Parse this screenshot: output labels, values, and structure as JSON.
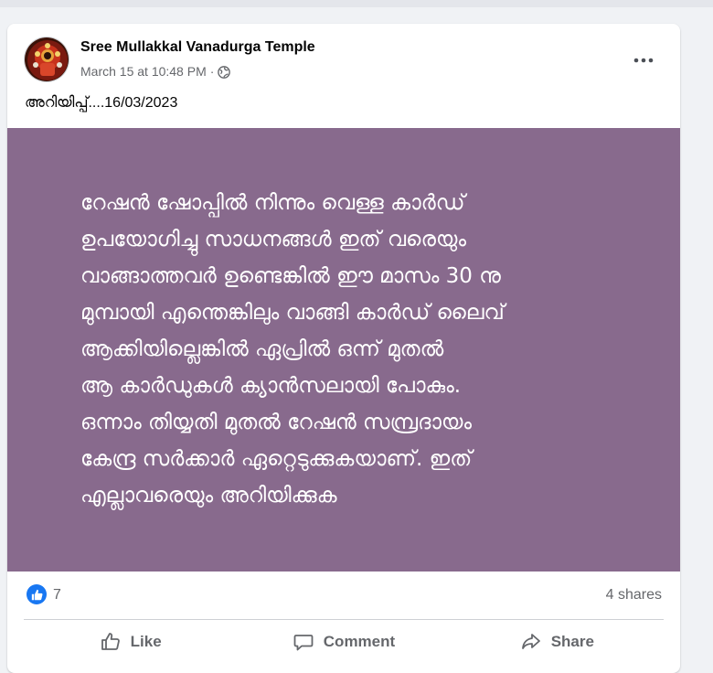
{
  "post": {
    "page_name": "Sree Mullakkal Vanadurga Temple",
    "timestamp": "March 15 at 10:48 PM",
    "separator": "·",
    "privacy_icon": "globe-icon",
    "text": "അറിയിപ്പ്....16/03/2023",
    "banner": {
      "background": "#886a8d",
      "lines": [
        "റേഷൻ ഷോപ്പിൽ നിന്നും വെള്ള കാർഡ്",
        "ഉപയോഗിച്ചു സാധനങ്ങൾ ഇത് വരെയും",
        "വാങ്ങാത്തവർ ഉണ്ടെങ്കിൽ ഈ മാസം 30 നു",
        "മുമ്പായി എന്തെങ്കിലും വാങ്ങി കാർഡ് ലൈവ്",
        "ആക്കിയില്ലെങ്കിൽ ഏപ്രിൽ ഒന്ന് മുതൽ",
        "ആ കാർഡുകൾ ക്യാൻസലായി പോകും.",
        "ഒന്നാം തിയ്യതി മുതൽ റേഷൻ സമ്പ്രദായം",
        "കേന്ദ്ര സർക്കാർ ഏറ്റെടുക്കുകയാണ്. ഇത്",
        "എല്ലാവരെയും അറിയിക്കുക"
      ]
    },
    "reactions": {
      "icon": "like-reaction-icon",
      "count": "7"
    },
    "shares": "4 shares"
  },
  "actions": {
    "like": {
      "label": "Like",
      "icon": "thumbs-up-icon"
    },
    "comment": {
      "label": "Comment",
      "icon": "comment-icon"
    },
    "share": {
      "label": "Share",
      "icon": "share-icon"
    }
  },
  "colors": {
    "accent": "#1877f2",
    "secondary_text": "#65676b",
    "banner": "#886a8d"
  }
}
